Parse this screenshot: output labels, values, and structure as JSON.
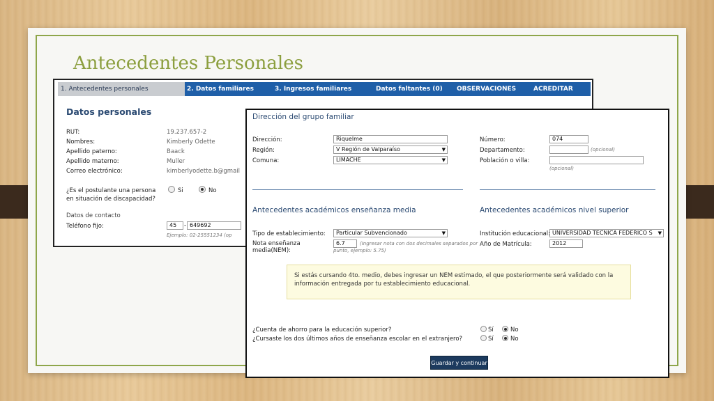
{
  "slide": {
    "title": "Antecedentes Personales"
  },
  "back": {
    "tabs": [
      {
        "label": "1. Antecedentes personales"
      },
      {
        "label": "2. Datos familiares"
      },
      {
        "label": "3. Ingresos familiares"
      },
      {
        "label": "Datos faltantes (0)"
      },
      {
        "label": "OBSERVACIONES"
      },
      {
        "label": "ACREDITAR"
      }
    ],
    "section_title": "Datos personales",
    "rut": {
      "label": "RUT:",
      "value": "19.237.657-2"
    },
    "nombres": {
      "label": "Nombres:",
      "value": "Kimberly Odette"
    },
    "paterno": {
      "label": "Apellido paterno:",
      "value": "Baack"
    },
    "materno": {
      "label": "Apellido materno:",
      "value": "Muller"
    },
    "correo": {
      "label": "Correo electrónico:",
      "value": "kimberlyodette.b@gmail"
    },
    "discapacidad": {
      "question_line1": "¿Es el postulante una persona",
      "question_line2": "en situación de discapacidad?",
      "yes": "Si",
      "no": "No"
    },
    "contacto_title": "Datos de contacto",
    "telefono": {
      "label": "Teléfono fijo:",
      "area": "45",
      "dash": "-",
      "number": "649692",
      "hint": "Ejemplo: 02-25551234 (op"
    }
  },
  "front": {
    "section_direccion": "Dirección del grupo familiar",
    "direccion": {
      "label": "Dirección:",
      "value": "Riquelme"
    },
    "region": {
      "label": "Región:",
      "value": "V Región de Valparaíso"
    },
    "comuna": {
      "label": "Comuna:",
      "value": "LIMACHE"
    },
    "numero": {
      "label": "Número:",
      "value": "074"
    },
    "departamento": {
      "label": "Departamento:",
      "value": "",
      "hint": "(opcional)"
    },
    "poblacion": {
      "label": "Población o villa:",
      "value": "",
      "hint": "(opcional)"
    },
    "section_media": "Antecedentes académicos enseñanza media",
    "section_superior": "Antecedentes académicos nivel superior",
    "tipo_est": {
      "label": "Tipo de establecimiento:",
      "value": "Particular Subvencionado"
    },
    "nem": {
      "label_line1": "Nota enseñanza",
      "label_line2": "media(NEM):",
      "value": "6.7",
      "hint_line1": "(Ingresar nota con dos decimales separados por",
      "hint_line2": "punto, ejemplo: 5.75)"
    },
    "institucion": {
      "label": "Institución educacional:",
      "value": "UNIVERSIDAD TECNICA FEDERICO S"
    },
    "matricula": {
      "label": "Año de Matrícula:",
      "value": "2012"
    },
    "notice": "Si estás cursando 4to. medio, debes ingresar un NEM estimado, el que posteriormente será validado con la información entregada por tu establecimiento educacional.",
    "q_ahorro": {
      "label": "¿Cuenta de ahorro para la educación superior?",
      "yes": "Sí",
      "no": "No"
    },
    "q_extranjero": {
      "label": "¿Cursaste los dos últimos años de enseñanza escolar en el extranjero?",
      "yes": "Sí",
      "no": "No"
    },
    "submit_label": "Guardar y continuar"
  }
}
